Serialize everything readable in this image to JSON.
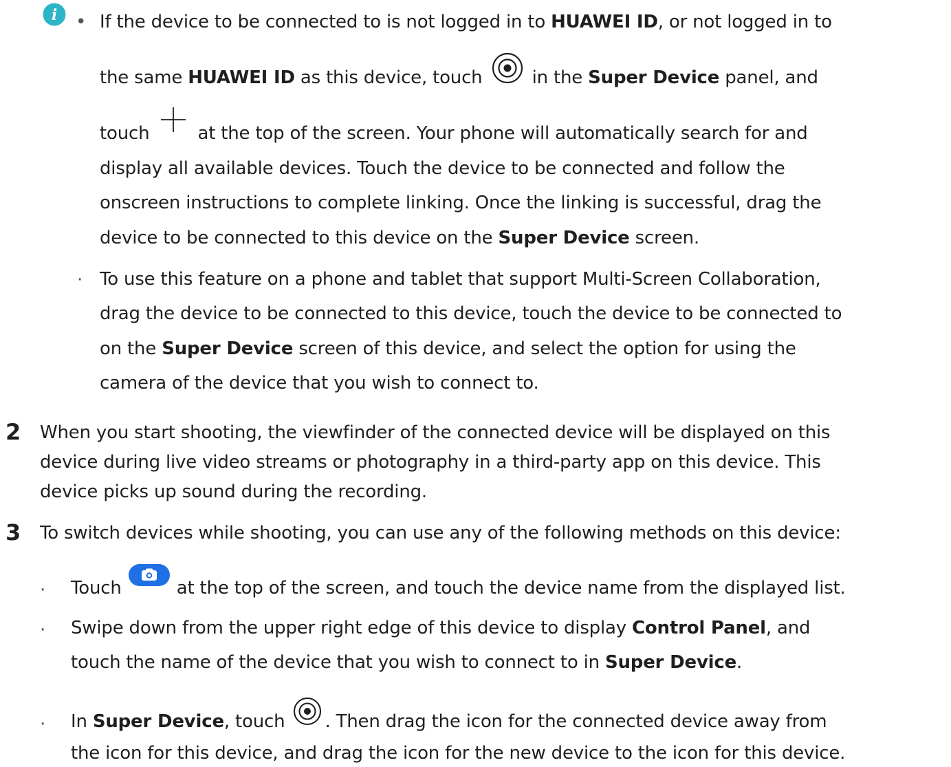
{
  "note": {
    "bullet1": {
      "l1a": "If the device to be connected to is not logged in to ",
      "l1b": "HUAWEI ID",
      "l1c": ", or not logged in to",
      "l2a": "the same ",
      "l2b": "HUAWEI ID",
      "l2c": " as this device, touch ",
      "l2d": " in the ",
      "l2e": "Super Device",
      "l2f": " panel, and",
      "l3a": "touch ",
      "l3b": " at the top of the screen. Your phone will automatically search for and",
      "l4": "display all available devices. Touch the device to be connected and follow the",
      "l5": "onscreen instructions to complete linking. Once the linking is successful, drag the",
      "l6a": "device to be connected to this device on the ",
      "l6b": "Super Device",
      "l6c": " screen."
    },
    "bullet2": {
      "l1": "To use this feature on a phone and tablet that support Multi-Screen Collaboration,",
      "l2": "drag the device to be connected to this device, touch the device to be connected to",
      "l3a": "on the ",
      "l3b": "Super Device",
      "l3c": " screen of this device, and select the option for using the",
      "l4": "camera of the device that you wish to connect to."
    }
  },
  "steps": {
    "s2": {
      "num": "2",
      "l1": "When you start shooting, the viewfinder of the connected device will be displayed on this",
      "l2": "device during live video streams or photography in a third-party app on this device. This",
      "l3": "device picks up sound during the recording."
    },
    "s3": {
      "num": "3",
      "l1": "To switch devices while shooting, you can use any of the following methods on this device:",
      "b1": {
        "a": "Touch ",
        "b": " at the top of the screen, and touch the device name from the displayed list."
      },
      "b2": {
        "l1a": "Swipe down from the upper right edge of this device to display ",
        "l1b": "Control Panel",
        "l1c": ", and",
        "l2a": "touch the name of the device that you wish to connect to in ",
        "l2b": "Super Device",
        "l2c": "."
      },
      "b3": {
        "l1a": "In ",
        "l1b": "Super Device",
        "l1c": ", touch ",
        "l1d": ". Then drag the icon for the connected device away from",
        "l2": "the icon for this device, and drag the icon for the new device to the icon for this device."
      }
    }
  },
  "icons": {
    "info": "info-icon",
    "super_device": "super-device-icon",
    "add": "add-icon",
    "camera_switch": "camera-switch-icon"
  },
  "colors": {
    "info_icon": "#2bb5c6",
    "camera_button": "#1f6fe5",
    "text": "#1f1f1f"
  }
}
